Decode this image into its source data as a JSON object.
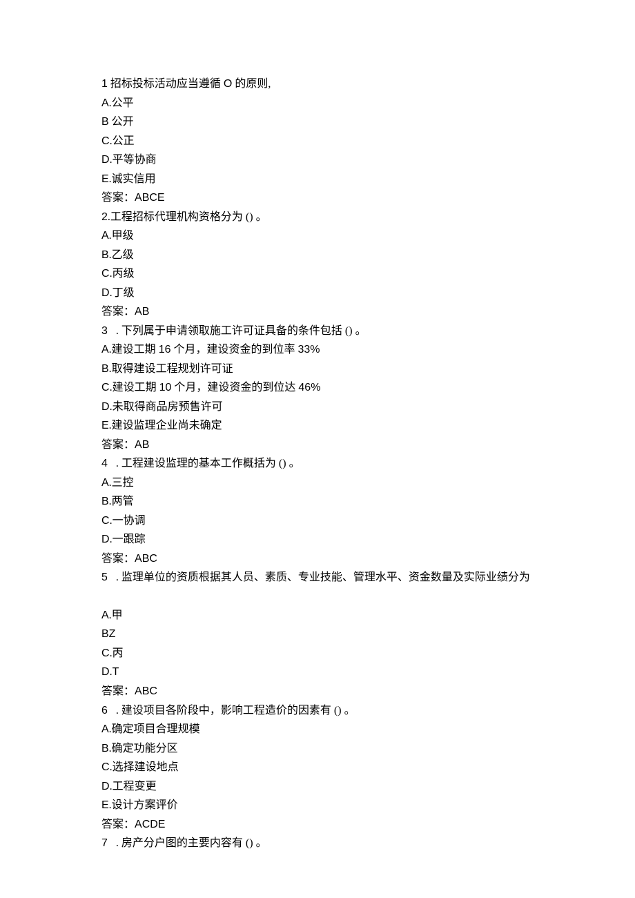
{
  "lines": [
    {
      "text": "1 招标投标活动应当遵循 O 的原则,"
    },
    {
      "text": "A.公平"
    },
    {
      "text": "B 公开"
    },
    {
      "text": "C.公正"
    },
    {
      "text": "D.平等协商"
    },
    {
      "text": "E.诚实信用"
    },
    {
      "text": "答案：ABCE"
    },
    {
      "text": "2.工程招标代理机构资格分为 () 。"
    },
    {
      "text": "A.甲级"
    },
    {
      "text": "B.乙级"
    },
    {
      "text": "C.丙级"
    },
    {
      "text": "D.丁级"
    },
    {
      "text": "答案：AB"
    },
    {
      "text": "3   . 下列属于申请领取施工许可证具备的条件包括 () 。"
    },
    {
      "text": "A.建设工期 16 个月，建设资金的到位率 33%"
    },
    {
      "text": "B.取得建设工程规划许可证"
    },
    {
      "text": "C.建设工期 10 个月，建设资金的到位达 46%"
    },
    {
      "text": "D.未取得商品房预售许可"
    },
    {
      "text": "E.建设监理企业尚未确定"
    },
    {
      "text": "答案：AB"
    },
    {
      "text": "4   . 工程建设监理的基本工作概括为 () 。"
    },
    {
      "text": "A.三控"
    },
    {
      "text": "B.两管"
    },
    {
      "text": "C.一协调"
    },
    {
      "text": "D.一跟踪"
    },
    {
      "text": "答案：ABC"
    },
    {
      "text": "5   . 监理单位的资质根据其人员、素质、专业技能、管理水平、资金数量及实际业绩分为"
    },
    {
      "blank": true
    },
    {
      "text": "A.甲"
    },
    {
      "text": "BZ"
    },
    {
      "text": "C.丙"
    },
    {
      "text": "D.T"
    },
    {
      "text": "答案：ABC"
    },
    {
      "text": "6   . 建设项目各阶段中，影响工程造价的因素有 () 。"
    },
    {
      "text": "A.确定项目合理规模"
    },
    {
      "text": "B.确定功能分区"
    },
    {
      "text": "C.选择建设地点"
    },
    {
      "text": "D.工程变更"
    },
    {
      "text": "E.设计方案评价"
    },
    {
      "text": "答案：ACDE"
    },
    {
      "text": "7   . 房产分户图的主要内容有 () 。"
    }
  ]
}
